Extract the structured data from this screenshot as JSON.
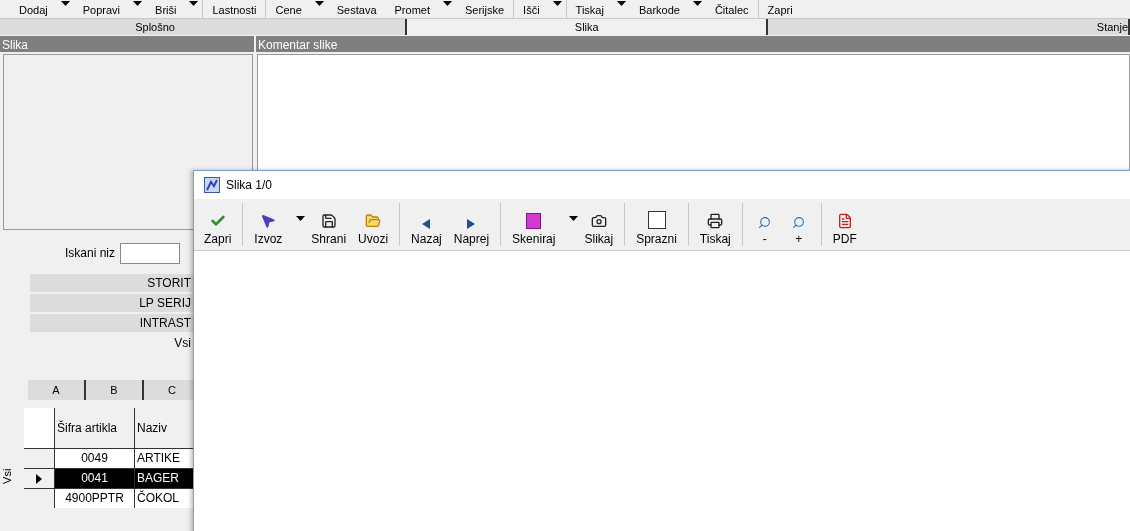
{
  "toolbar": [
    {
      "label": "Dodaj",
      "dropdown": true
    },
    {
      "label": "Popravi",
      "dropdown": true
    },
    {
      "label": "Briši",
      "dropdown": true,
      "separator": true
    },
    {
      "label": "Lastnosti",
      "separator": true
    },
    {
      "label": "Cene",
      "dropdown": true
    },
    {
      "label": "Sestava"
    },
    {
      "label": "Promet",
      "dropdown": true
    },
    {
      "label": "Serijske",
      "separator": true
    },
    {
      "label": "Išči",
      "dropdown": true,
      "separator": true
    },
    {
      "label": "Tiskaj",
      "dropdown": true
    },
    {
      "label": "Barkode",
      "dropdown": true
    },
    {
      "label": "Čitalec",
      "separator": true
    },
    {
      "label": "Zapri"
    }
  ],
  "tabs": [
    {
      "label": "Splošno",
      "selected": false
    },
    {
      "label": "Slika",
      "selected": true
    },
    {
      "label": "Stanje",
      "selected": false
    }
  ],
  "panels": {
    "left_header": "Slika",
    "right_header": "Komentar slike"
  },
  "search": {
    "label": "Iskani niz"
  },
  "groups": [
    {
      "label": "STORIT",
      "selected": false
    },
    {
      "label": "LP SERIJ",
      "selected": false
    },
    {
      "label": "INTRAST",
      "selected": false
    },
    {
      "label": "Vsi",
      "selected": true
    }
  ],
  "grid_tabs": [
    {
      "label": "A",
      "selected": false
    },
    {
      "label": "B",
      "selected": false
    },
    {
      "label": "C",
      "selected": false
    }
  ],
  "side_label": "Vsi",
  "table": {
    "columns": [
      "Šifra artikla",
      "Naziv"
    ],
    "rows": [
      {
        "cells": [
          "0049",
          "ARTIKE"
        ],
        "selected": false
      },
      {
        "cells": [
          "0041",
          "BAGER"
        ],
        "selected": true
      },
      {
        "cells": [
          "4900PPTR",
          "ČOKOL"
        ],
        "selected": false
      }
    ]
  },
  "dialog": {
    "title": "Slika 1/0",
    "toolbar": [
      {
        "label": "Zapri",
        "kind": "check",
        "separator": true
      },
      {
        "label": "Izvoz",
        "kind": "pointer",
        "dropdown": true
      },
      {
        "label": "Shrani",
        "kind": "save"
      },
      {
        "label": "Uvozi",
        "kind": "folder",
        "separator": true
      },
      {
        "label": "Nazaj",
        "kind": "left"
      },
      {
        "label": "Naprej",
        "kind": "right",
        "separator": true
      },
      {
        "label": "Skeniraj",
        "kind": "scan",
        "dropdown": true
      },
      {
        "label": "Slikaj",
        "kind": "camera",
        "separator": true
      },
      {
        "label": "Sprazni",
        "kind": "square",
        "separator": true
      },
      {
        "label": "Tiskaj",
        "kind": "printer",
        "separator": true
      },
      {
        "label": "-",
        "kind": "zoom"
      },
      {
        "label": "+",
        "kind": "zoom",
        "separator": true
      },
      {
        "label": "PDF",
        "kind": "pdf"
      }
    ]
  }
}
